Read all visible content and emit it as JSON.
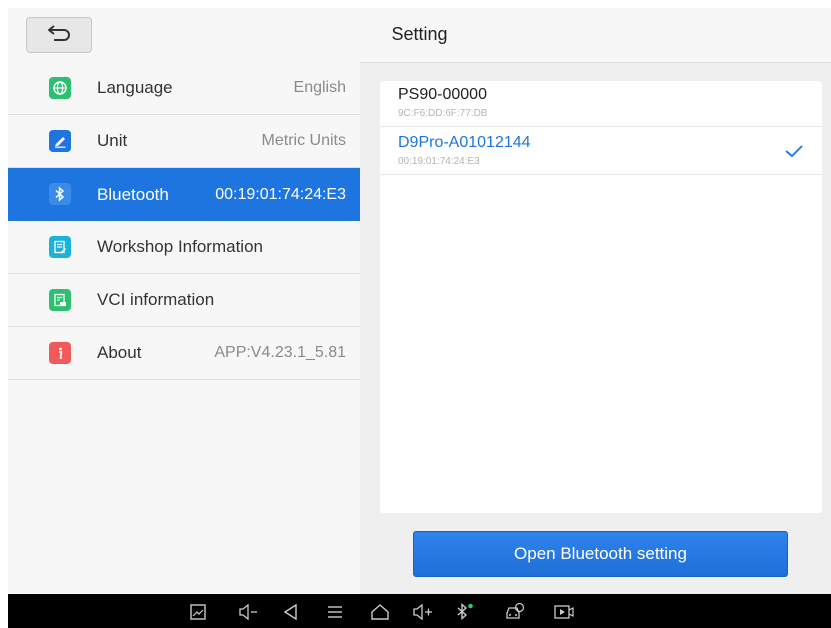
{
  "header": {
    "title": "Setting"
  },
  "sidebar": {
    "items": [
      {
        "label": "Language",
        "value": "English",
        "icon": "globe-icon",
        "color": "#2fbf71"
      },
      {
        "label": "Unit",
        "value": "Metric Units",
        "icon": "ruler-pencil-icon",
        "color": "#1e75e0"
      },
      {
        "label": "Bluetooth",
        "value": "00:19:01:74:24:E3",
        "icon": "bluetooth-icon",
        "color": "#1e75e0",
        "active": true
      },
      {
        "label": "Workshop Information",
        "value": "",
        "icon": "document-edit-icon",
        "color": "#1ab2d6"
      },
      {
        "label": "VCI information",
        "value": "",
        "icon": "vci-doc-icon",
        "color": "#2fbf71"
      },
      {
        "label": "About",
        "value": "APP:V4.23.1_5.81",
        "icon": "info-icon",
        "color": "#f05a5a"
      }
    ]
  },
  "bluetooth": {
    "devices": [
      {
        "name": "PS90-00000",
        "mac": "9C:F6:DD:6F:77:DB",
        "connected": false
      },
      {
        "name": "D9Pro-A01012144",
        "mac": "00:19:01:74:24:E3",
        "connected": true
      }
    ],
    "open_button": "Open Bluetooth setting"
  },
  "colors": {
    "accent": "#1e75e0",
    "background": "#efefef",
    "navbar": "#000000"
  },
  "navbar": {
    "icons": [
      "screenshot-icon",
      "volume-down-icon",
      "back-icon",
      "menu-icon",
      "home-icon",
      "volume-up-icon",
      "bluetooth-status-icon",
      "car-diagnostic-icon",
      "screen-record-icon"
    ]
  }
}
